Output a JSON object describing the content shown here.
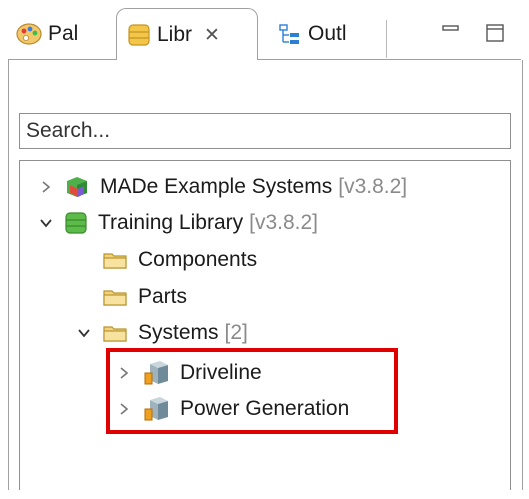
{
  "tabs": [
    {
      "label": "Pal",
      "icon": "palette-icon"
    },
    {
      "label": "Libr",
      "icon": "library-icon",
      "close": "✕"
    },
    {
      "label": "Outl",
      "icon": "outline-icon"
    }
  ],
  "window_controls": [
    "minimize-icon",
    "maximize-icon"
  ],
  "search": {
    "placeholder": "Search..."
  },
  "tree": {
    "nodes": [
      {
        "label": "MADe Example Systems",
        "version": "[v3.8.2]",
        "state": "collapsed"
      },
      {
        "label": "Training Library",
        "version": "[v3.8.2]",
        "state": "expanded"
      },
      {
        "label": "Components"
      },
      {
        "label": "Parts"
      },
      {
        "label": "Systems",
        "count": "[2]",
        "state": "expanded"
      },
      {
        "label": "Driveline",
        "state": "collapsed"
      },
      {
        "label": "Power Generation",
        "state": "collapsed"
      }
    ]
  },
  "colors": {
    "highlight": "#e00000",
    "folder": "#f3d27a",
    "library": "#5dbb4a"
  }
}
